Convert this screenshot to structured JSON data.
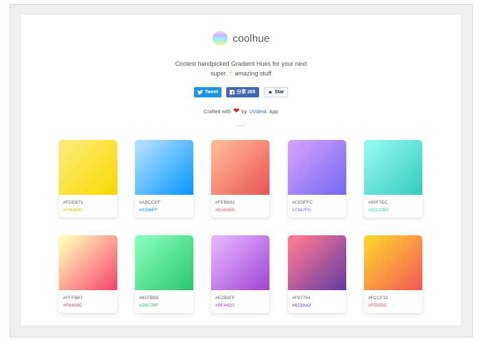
{
  "brand": {
    "name": "coolhue"
  },
  "tagline": {
    "line1": "Coolest handpicked Gradient Hues for your next",
    "line2_pre": "super",
    "line2_emoji": "⚡",
    "line2_post": "amazing stuff"
  },
  "social": {
    "tweet": "Tweet",
    "share": "分享 265",
    "star": "Star",
    "twitter_icon": "twitter-bird-icon",
    "facebook_icon": "facebook-f-icon",
    "star_icon": "star-icon"
  },
  "crafted": {
    "pre": "Crafted with",
    "heart": "❤",
    "by": "by",
    "link": "UVdesk",
    "post": "App"
  },
  "more_indicator": "...",
  "gradients": [
    {
      "start": "#FDEB71",
      "end": "#F8D800",
      "start_color": "#FDEB71",
      "end_color": "#F8D800",
      "label_color": "#E8C300"
    },
    {
      "start": "#ABDCFF",
      "end": "#0396FF",
      "start_color": "#ABDCFF",
      "end_color": "#0396FF",
      "label_color": "#0396FF"
    },
    {
      "start": "#FEB692",
      "end": "#EA5455",
      "start_color": "#FEB692",
      "end_color": "#EA5455",
      "label_color": "#EA5455"
    },
    {
      "start": "#CE9FFC",
      "end": "#7367F0",
      "start_color": "#CE9FFC",
      "end_color": "#7367F0",
      "label_color": "#7367F0"
    },
    {
      "start": "#90F7EC",
      "end": "#32CCBC",
      "start_color": "#90F7EC",
      "end_color": "#32CCBC",
      "label_color": "#32CCBC"
    },
    {
      "start": "#FFF6B7",
      "end": "#F6416C",
      "start_color": "#FFF6B7",
      "end_color": "#F6416C",
      "label_color": "#F6416C"
    },
    {
      "start": "#81FBB8",
      "end": "#28C76F",
      "start_color": "#81FBB8",
      "end_color": "#28C76F",
      "label_color": "#28C76F"
    },
    {
      "start": "#E2B0FF",
      "end": "#9F44D3",
      "start_color": "#E2B0FF",
      "end_color": "#9F44D3",
      "label_color": "#9F44D3"
    },
    {
      "start": "#F97794",
      "end": "#623AA2",
      "start_color": "#F97794",
      "end_color": "#623AA2",
      "label_color": "#623AA2"
    },
    {
      "start": "#FCCF31",
      "end": "#F55555",
      "start_color": "#FCCF31",
      "end_color": "#F55555",
      "label_color": "#F55555"
    }
  ]
}
